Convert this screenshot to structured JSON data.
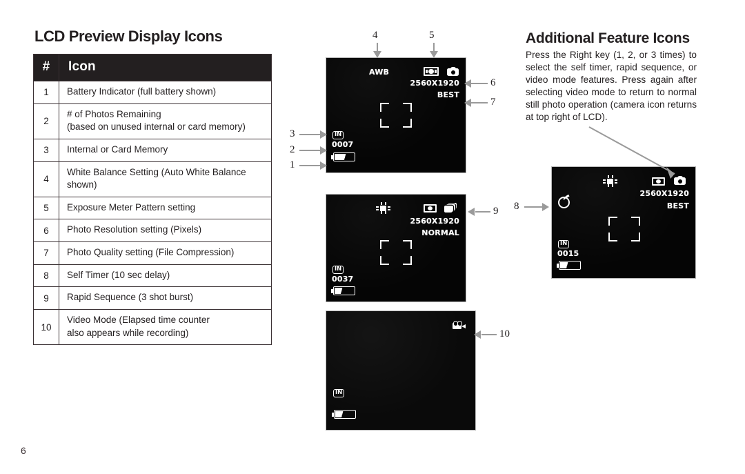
{
  "table": {
    "title": "LCD Preview Display Icons",
    "headers": [
      "#",
      "Icon"
    ],
    "rows": [
      {
        "num": "1",
        "desc": "Battery Indicator (full battery shown)",
        "desc2": ""
      },
      {
        "num": "2",
        "desc": "# of Photos Remaining",
        "desc2": "(based on unused internal or card memory)"
      },
      {
        "num": "3",
        "desc": "Internal or Card Memory",
        "desc2": ""
      },
      {
        "num": "4",
        "desc": "White Balance Setting (Auto White Balance shown)",
        "desc2": ""
      },
      {
        "num": "5",
        "desc": "Exposure Meter Pattern setting",
        "desc2": ""
      },
      {
        "num": "6",
        "desc": "Photo Resolution setting (Pixels)",
        "desc2": ""
      },
      {
        "num": "7",
        "desc": "Photo Quality setting (File Compression)",
        "desc2": ""
      },
      {
        "num": "8",
        "desc": "Self Timer (10 sec delay)",
        "desc2": ""
      },
      {
        "num": "9",
        "desc": "Rapid Sequence (3 shot burst)",
        "desc2": ""
      },
      {
        "num": "10",
        "desc": "Video Mode (Elapsed time counter",
        "desc2": "also appears while recording)"
      }
    ]
  },
  "feature_section": {
    "title": "Additional Feature Icons",
    "body": "Press the Right key (1, 2, or 3 times) to select the self timer, rapid sequence, or video mode features. Press again after selecting video mode to return to normal still photo operation (camera icon returns at top right of LCD)."
  },
  "page_number": "6",
  "lcd_screens": [
    {
      "id": "lcd-1",
      "name": "still-photo-lcd-preview",
      "white_balance": "AWB",
      "resolution": "2560X1920",
      "quality": "BEST",
      "memory": "IN",
      "photos_remaining": "0007",
      "exposure_meter_icon": "multi-pattern-meter-icon",
      "mode_icon": "still-camera-icon"
    },
    {
      "id": "lcd-2",
      "name": "rapid-sequence-lcd-preview",
      "white_balance_icon": "daylight-sun-icon",
      "resolution": "2560X1920",
      "quality": "NORMAL",
      "memory": "IN",
      "photos_remaining": "0037",
      "exposure_meter_icon": "spot-meter-icon",
      "mode_icon": "rapid-sequence-burst-icon"
    },
    {
      "id": "lcd-3",
      "name": "video-mode-lcd-preview",
      "memory": "IN",
      "mode_icon": "video-camera-icon"
    },
    {
      "id": "lcd-4",
      "name": "self-timer-lcd-preview",
      "white_balance_icon": "daylight-sun-icon",
      "resolution": "2560X1920",
      "quality": "BEST",
      "memory": "IN",
      "photos_remaining": "0015",
      "exposure_meter_icon": "spot-meter-icon",
      "mode_icon": "still-camera-icon",
      "self_timer_icon": "self-timer-clock-icon"
    }
  ],
  "callouts": [
    {
      "label": "1",
      "target": "battery-indicator"
    },
    {
      "label": "2",
      "target": "photos-remaining"
    },
    {
      "label": "3",
      "target": "memory-indicator"
    },
    {
      "label": "4",
      "target": "white-balance-setting"
    },
    {
      "label": "5",
      "target": "exposure-meter-setting"
    },
    {
      "label": "6",
      "target": "photo-resolution-setting"
    },
    {
      "label": "7",
      "target": "photo-quality-setting"
    },
    {
      "label": "8",
      "target": "self-timer-icon"
    },
    {
      "label": "9",
      "target": "rapid-sequence-icon"
    },
    {
      "label": "10",
      "target": "video-mode-icon"
    }
  ],
  "colors": {
    "header_bg": "#231f20",
    "border": "#3b3134",
    "lcd_bg": "#050505",
    "callout_gray": "#9a9a9a"
  }
}
